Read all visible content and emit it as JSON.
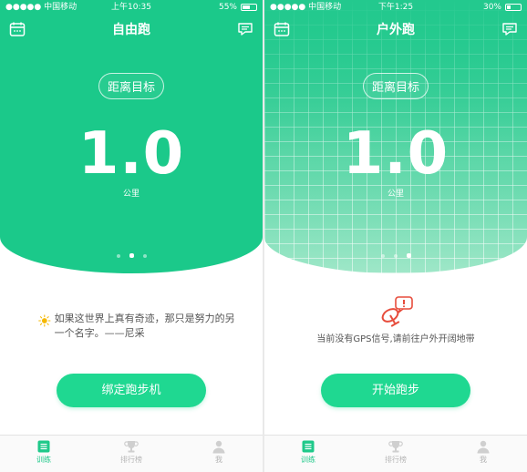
{
  "screens": [
    {
      "status": {
        "carrier": "●●●●● 中国移动",
        "time": "上午10:35",
        "battery": "55%",
        "battery_level": 0.55
      },
      "title": "自由跑",
      "goal_label": "距离目标",
      "distance": "1.0",
      "unit": "公里",
      "page_indicator": {
        "count": 3,
        "active_index": 1
      },
      "quote": "如果这世界上真有奇迹，那只是努力的另一个名字。——尼采",
      "action_button": "绑定跑步机",
      "tabs": [
        {
          "label": "训练",
          "icon": "train-icon",
          "active": true
        },
        {
          "label": "排行榜",
          "icon": "trophy-icon",
          "active": false
        },
        {
          "label": "我",
          "icon": "user-icon",
          "active": false
        }
      ]
    },
    {
      "status": {
        "carrier": "●●●●● 中国移动",
        "time": "下午1:25",
        "battery": "30%",
        "battery_level": 0.3
      },
      "title": "户外跑",
      "goal_label": "距离目标",
      "distance": "1.0",
      "unit": "公里",
      "page_indicator": {
        "count": 3,
        "active_index": 2
      },
      "gps_message": "当前没有GPS信号,请前往户外开阔地带",
      "action_button": "开始跑步",
      "tabs": [
        {
          "label": "训练",
          "icon": "train-icon",
          "active": true
        },
        {
          "label": "排行榜",
          "icon": "trophy-icon",
          "active": false
        },
        {
          "label": "我",
          "icon": "user-icon",
          "active": false
        }
      ]
    }
  ],
  "colors": {
    "primary_green": "#1bc98a",
    "button_green": "#1fd891",
    "gps_alert_red": "#e74c3c",
    "sun_yellow": "#f5b800"
  }
}
